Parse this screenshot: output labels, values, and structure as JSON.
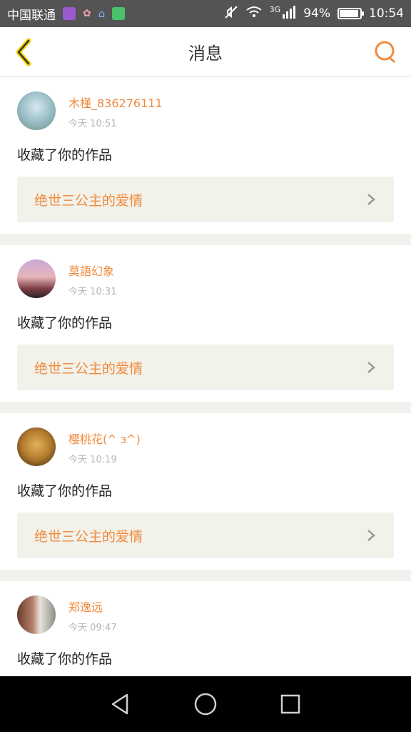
{
  "status_bar": {
    "carrier": "中国联通",
    "network": "3G",
    "battery_text": "94%",
    "battery_level": 0.94,
    "time": "10:54",
    "icons": [
      "gallery-icon",
      "flower-icon",
      "home-icon",
      "stocks-icon",
      "mute-icon",
      "wifi-icon",
      "signal-icon",
      "battery-icon"
    ]
  },
  "header": {
    "title": "消息",
    "back_icon": "chevron-left-icon",
    "search_icon": "search-icon"
  },
  "accent_color": "#f08a3c",
  "messages": [
    {
      "username": "木槿_836276111",
      "time": "今天 10:51",
      "action": "收藏了你的作品",
      "work_title": "绝世三公主的爱情"
    },
    {
      "username": "莫語幻象",
      "time": "今天 10:31",
      "action": "收藏了你的作品",
      "work_title": "绝世三公主的爱情"
    },
    {
      "username": "樱桃花(^ з^)",
      "time": "今天 10:19",
      "action": "收藏了你的作品",
      "work_title": "绝世三公主的爱情"
    },
    {
      "username": "郑逸远",
      "time": "今天 09:47",
      "action": "收藏了你的作品",
      "work_title": ""
    }
  ],
  "system_nav": [
    "back-triangle-icon",
    "home-circle-icon",
    "recents-square-icon"
  ]
}
